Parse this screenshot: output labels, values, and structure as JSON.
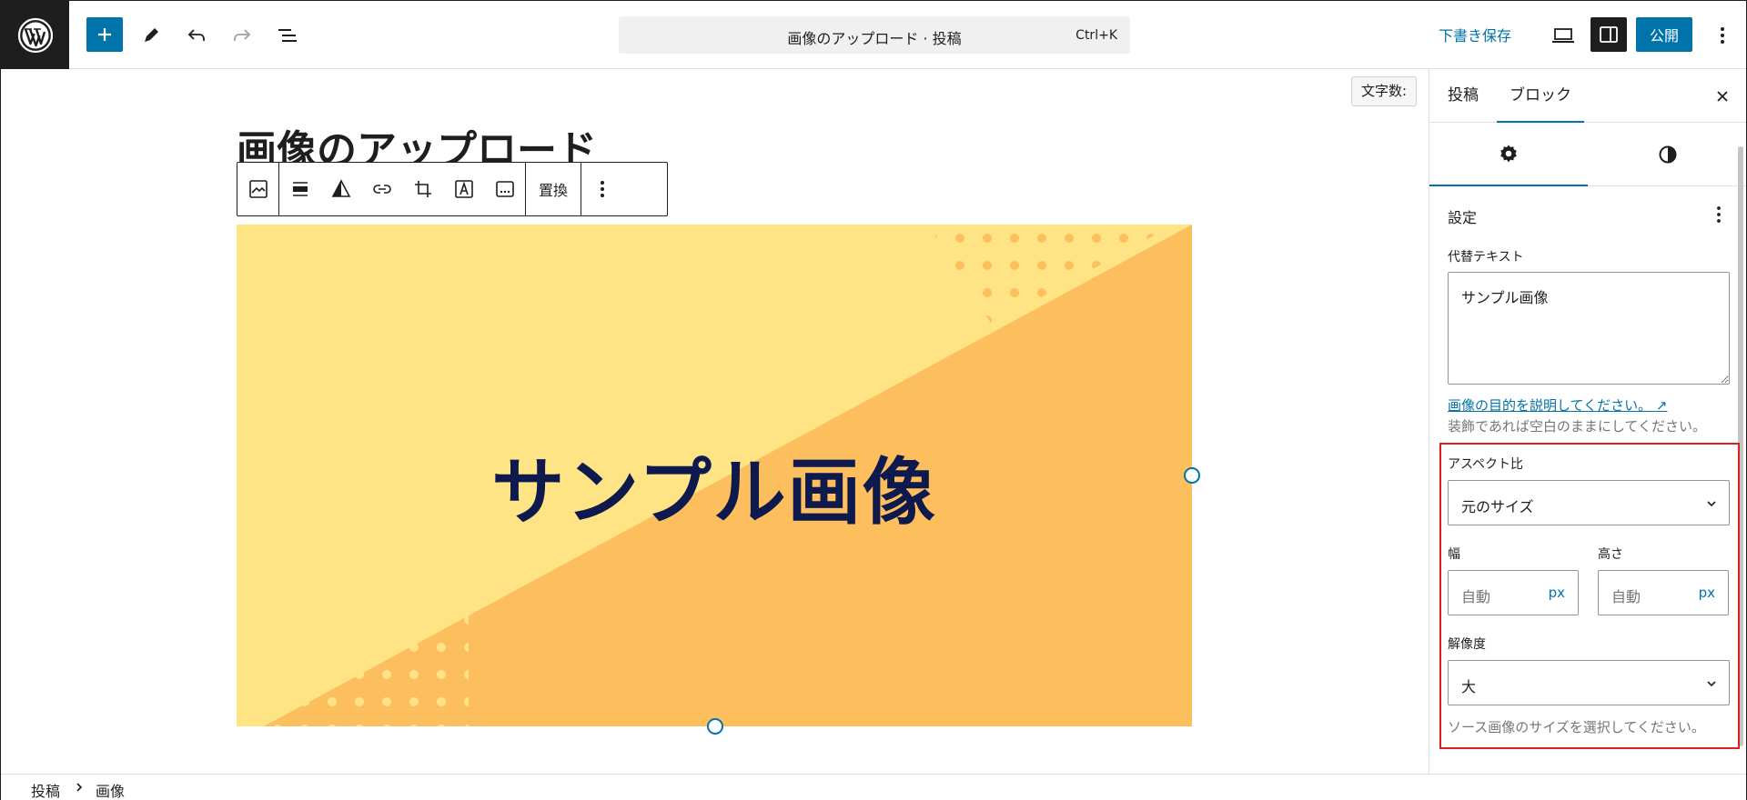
{
  "header": {
    "command_title": "画像のアップロード · 投稿",
    "command_shortcut": "Ctrl+K",
    "save_draft": "下書き保存",
    "publish": "公開"
  },
  "editor": {
    "word_count": "文字数:",
    "post_title": "画像のアップロード",
    "replace_label": "置換",
    "image_text": "サンプル画像"
  },
  "sidebar": {
    "tabs": [
      "投稿",
      "ブロック"
    ],
    "active_tab": "ブロック",
    "settings_title": "設定",
    "alt_label": "代替テキスト",
    "alt_value": "サンプル画像",
    "alt_help_link": "画像の目的を説明してください。",
    "alt_help_text": "装飾であれば空白のままにしてください。",
    "aspect_label": "アスペクト比",
    "aspect_value": "元のサイズ",
    "width_label": "幅",
    "height_label": "高さ",
    "width_placeholder": "自動",
    "height_placeholder": "自動",
    "unit": "px",
    "resolution_label": "解像度",
    "resolution_value": "大",
    "resolution_help": "ソース画像のサイズを選択してください。"
  },
  "breadcrumb": [
    "投稿",
    "画像"
  ],
  "colors": {
    "accent": "#0073aa",
    "image_light": "#ffe485",
    "image_dark": "#fdbe5e",
    "image_text": "#0e1a4d",
    "highlight": "#e0201f"
  }
}
